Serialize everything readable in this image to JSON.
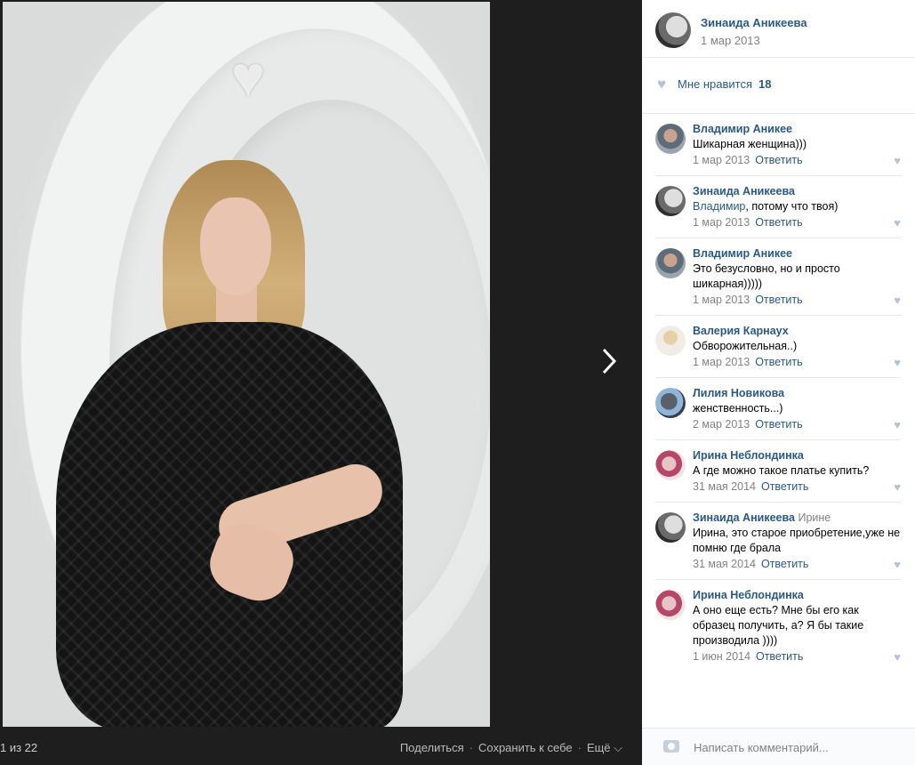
{
  "viewer": {
    "counter": "1 из 22",
    "actions": [
      "Поделиться",
      "Сохранить к себе",
      "Ещё ⌵"
    ],
    "separator": "·"
  },
  "post": {
    "author": "Зинаида Аникеева",
    "date": "1 мар 2013",
    "like_label": "Мне нравится",
    "like_count": "18"
  },
  "comments": [
    {
      "name": "Владимир Аникее",
      "reply_to": "",
      "mention": "",
      "text": "Шикарная женщина)))",
      "date": "1 мар 2013"
    },
    {
      "name": "Зинаида Аникеева",
      "reply_to": "",
      "mention": "Владимир",
      "text": ", потому что твоя)",
      "date": "1 мар 2013"
    },
    {
      "name": "Владимир Аникее",
      "reply_to": "",
      "mention": "",
      "text": "Это безусловно, но и просто шикарная)))))",
      "date": "1 мар 2013"
    },
    {
      "name": "Валерия Карнаух",
      "reply_to": "",
      "mention": "",
      "text": "Обворожительная..)",
      "date": "1 мар 2013"
    },
    {
      "name": "Лилия Новикова",
      "reply_to": "",
      "mention": "",
      "text": "женственность...)",
      "date": "2 мар 2013"
    },
    {
      "name": "Ирина Неблондинка",
      "reply_to": "",
      "mention": "",
      "text": "А где можно такое платье купить?",
      "date": "31 мая 2014"
    },
    {
      "name": "Зинаида Аникеева",
      "reply_to": "Ирине",
      "mention": "",
      "text": "Ирина, это старое приобретение,уже не помню где брала",
      "date": "31 мая 2014"
    },
    {
      "name": "Ирина Неблондинка",
      "reply_to": "",
      "mention": "",
      "text": "А оно еще есть? Мне бы его как образец получить, а? Я бы такие производила ))))",
      "date": "1 июн 2014"
    }
  ],
  "reply_label": "Ответить",
  "compose": {
    "placeholder": "Написать комментарий..."
  },
  "icons": {
    "heart": "heart-icon",
    "arrow": "chevron-right-icon",
    "camera": "camera-icon"
  },
  "colors": {
    "link": "#2a5885",
    "muted": "#828282",
    "like": "#b4c3d3",
    "viewer_bg": "#1e1e1e"
  }
}
